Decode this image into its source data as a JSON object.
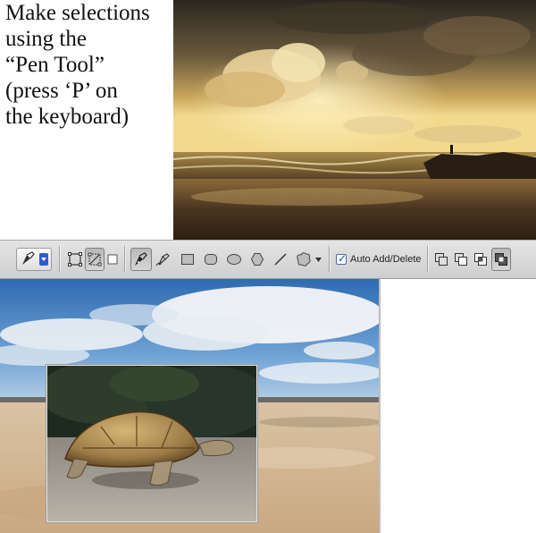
{
  "instruction": {
    "text": "Make selections\nusing the\n“Pen Tool”\n(press ‘P’ on\nthe keyboard)"
  },
  "toolbar": {
    "auto_add_delete_label": "Auto Add/Delete",
    "auto_add_delete_checked": true,
    "icons": [
      "pen-tool-preset-icon",
      "shape-layers-icon",
      "paths-icon",
      "fill-pixels-icon",
      "pen-icon",
      "freeform-pen-icon",
      "rectangle-icon",
      "rounded-rectangle-icon",
      "ellipse-icon",
      "polygon-icon",
      "line-icon",
      "custom-shape-icon",
      "add-to-path-icon",
      "subtract-from-path-icon",
      "intersect-path-icon",
      "exclude-overlap-icon"
    ]
  },
  "images": {
    "top": "sunset-beach-photo",
    "bottom": "beach-sky-photo",
    "inset": "tortoise-photo"
  }
}
